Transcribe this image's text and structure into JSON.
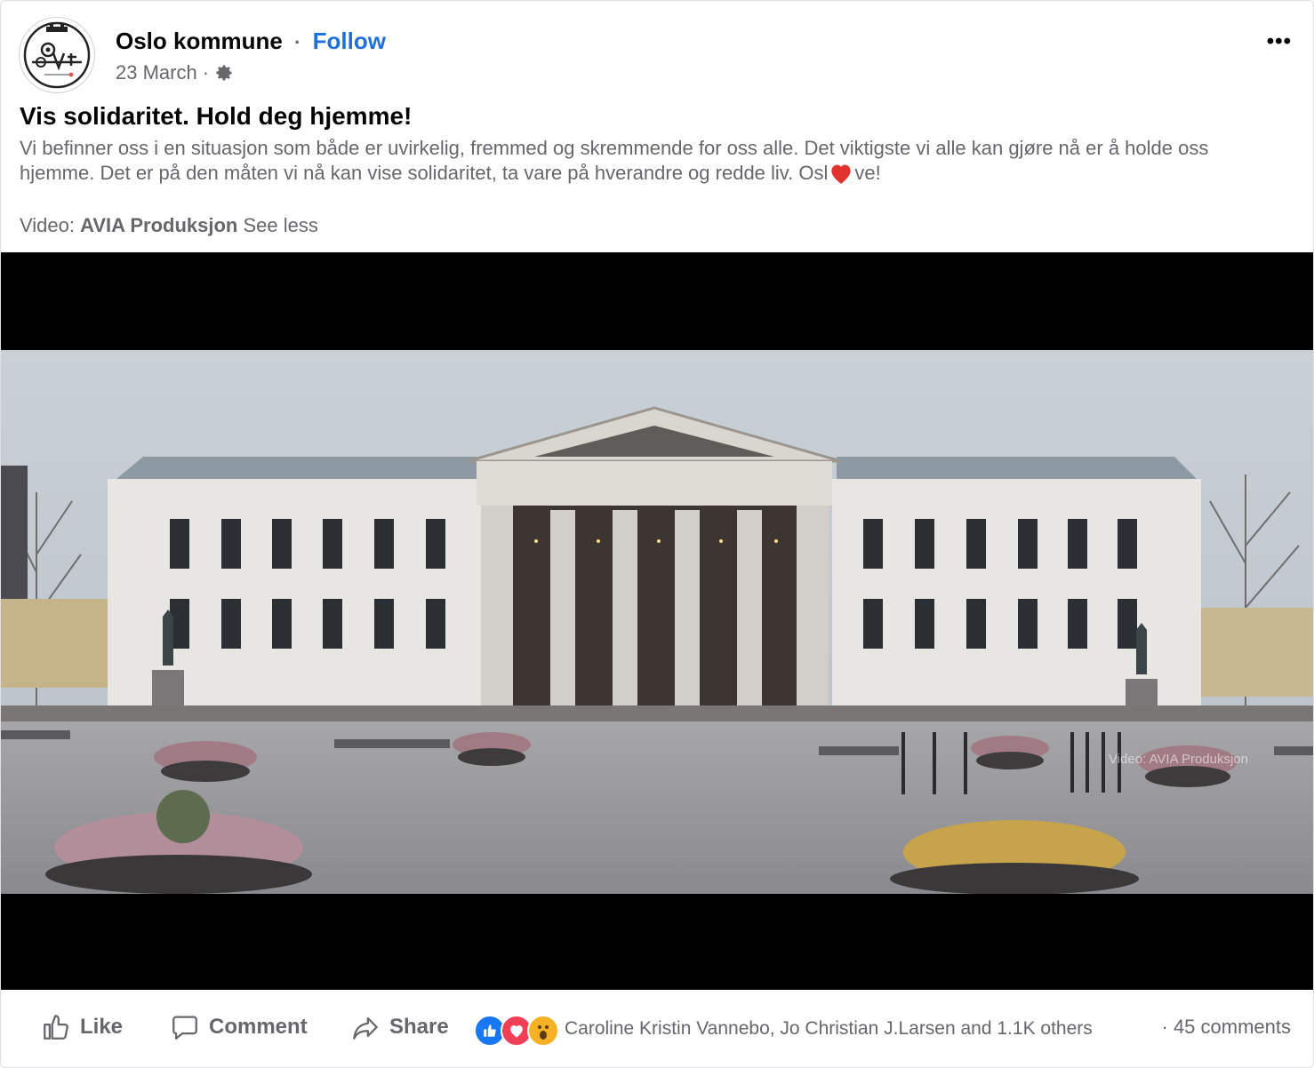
{
  "post": {
    "page_name": "Oslo kommune",
    "separator": "·",
    "follow_label": "Follow",
    "date": "23 March",
    "title": "Vis solidaritet. Hold deg hjemme!",
    "body_part1": "Vi befinner oss i en situasjon som både er uvirkelig, fremmed og skremmende for oss alle. Det viktigste vi alle kan gjøre nå er å holde oss hjemme. Det er på den måten vi nå kan vise solidaritet, ta vare på hverandre og redde liv. Osl",
    "body_part2": "ve!",
    "credit_prefix": "Video:",
    "credit_name": "AVIA Produksjon",
    "see_less": "See less",
    "more_label": "•••"
  },
  "video": {
    "watermark": "Video: AVIA Produksjon"
  },
  "actions": {
    "like": "Like",
    "comment": "Comment",
    "share": "Share"
  },
  "engagement": {
    "reactions_text": "Caroline Kristin Vannebo, Jo Christian J.Larsen and 1.1K others",
    "separator": "·",
    "comments_text": "45 comments"
  },
  "icons": [
    "gear-icon",
    "more-icon",
    "like-icon",
    "comment-icon",
    "share-icon",
    "like-reaction-icon",
    "love-reaction-icon",
    "wow-reaction-icon",
    "heart-emoji-icon"
  ],
  "colors": {
    "link": "#216fdb",
    "secondary_text": "#65676b",
    "like_blue": "#1877f2",
    "love_red": "#f33e58",
    "wow_yellow": "#f7b125"
  }
}
